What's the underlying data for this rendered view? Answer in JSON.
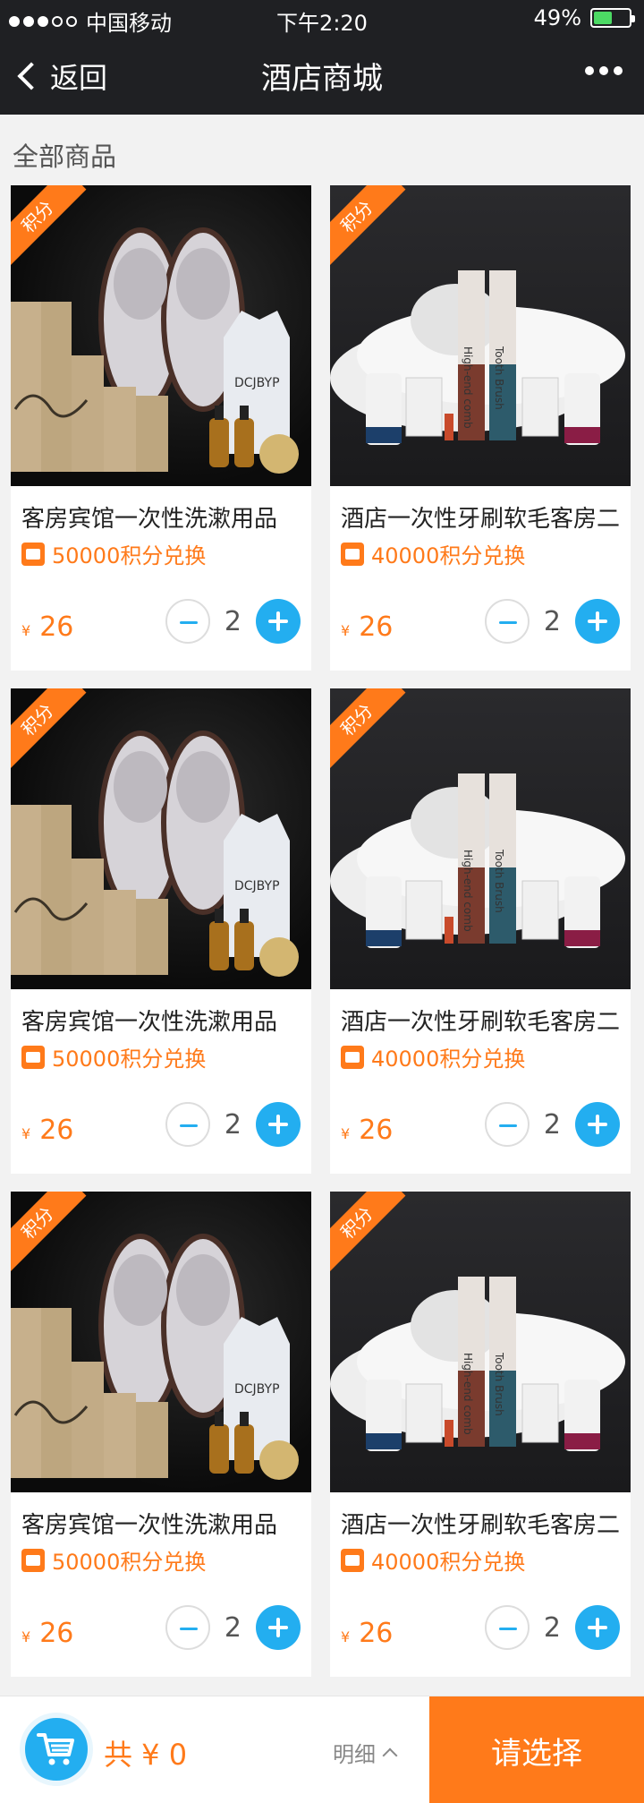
{
  "status": {
    "carrier": "中国移动",
    "time": "下午2:20",
    "battery": "49%"
  },
  "nav": {
    "back_label": "返回",
    "title": "酒店商城"
  },
  "section": {
    "title": "全部商品"
  },
  "products": [
    {
      "name": "客房宾馆一次性洗漱用品",
      "points": "50000积分兑换",
      "price": "26",
      "qty": "2",
      "badge": "积分",
      "variant": "a"
    },
    {
      "name": "酒店一次性牙刷软毛客房二",
      "points": "40000积分兑换",
      "price": "26",
      "qty": "2",
      "badge": "积分",
      "variant": "b"
    },
    {
      "name": "客房宾馆一次性洗漱用品",
      "points": "50000积分兑换",
      "price": "26",
      "qty": "2",
      "badge": "积分",
      "variant": "a"
    },
    {
      "name": "酒店一次性牙刷软毛客房二",
      "points": "40000积分兑换",
      "price": "26",
      "qty": "2",
      "badge": "积分",
      "variant": "b"
    },
    {
      "name": "客房宾馆一次性洗漱用品",
      "points": "50000积分兑换",
      "price": "26",
      "qty": "2",
      "badge": "积分",
      "variant": "a"
    },
    {
      "name": "酒店一次性牙刷软毛客房二",
      "points": "40000积分兑换",
      "price": "26",
      "qty": "2",
      "badge": "积分",
      "variant": "b"
    }
  ],
  "currency_symbol": "¥",
  "bottom": {
    "total_label": "共 ¥ 0",
    "detail_label": "明细",
    "select_label": "请选择"
  },
  "colors": {
    "accent": "#ff7a1a",
    "blue": "#23aef0",
    "nav": "#1f2023"
  }
}
